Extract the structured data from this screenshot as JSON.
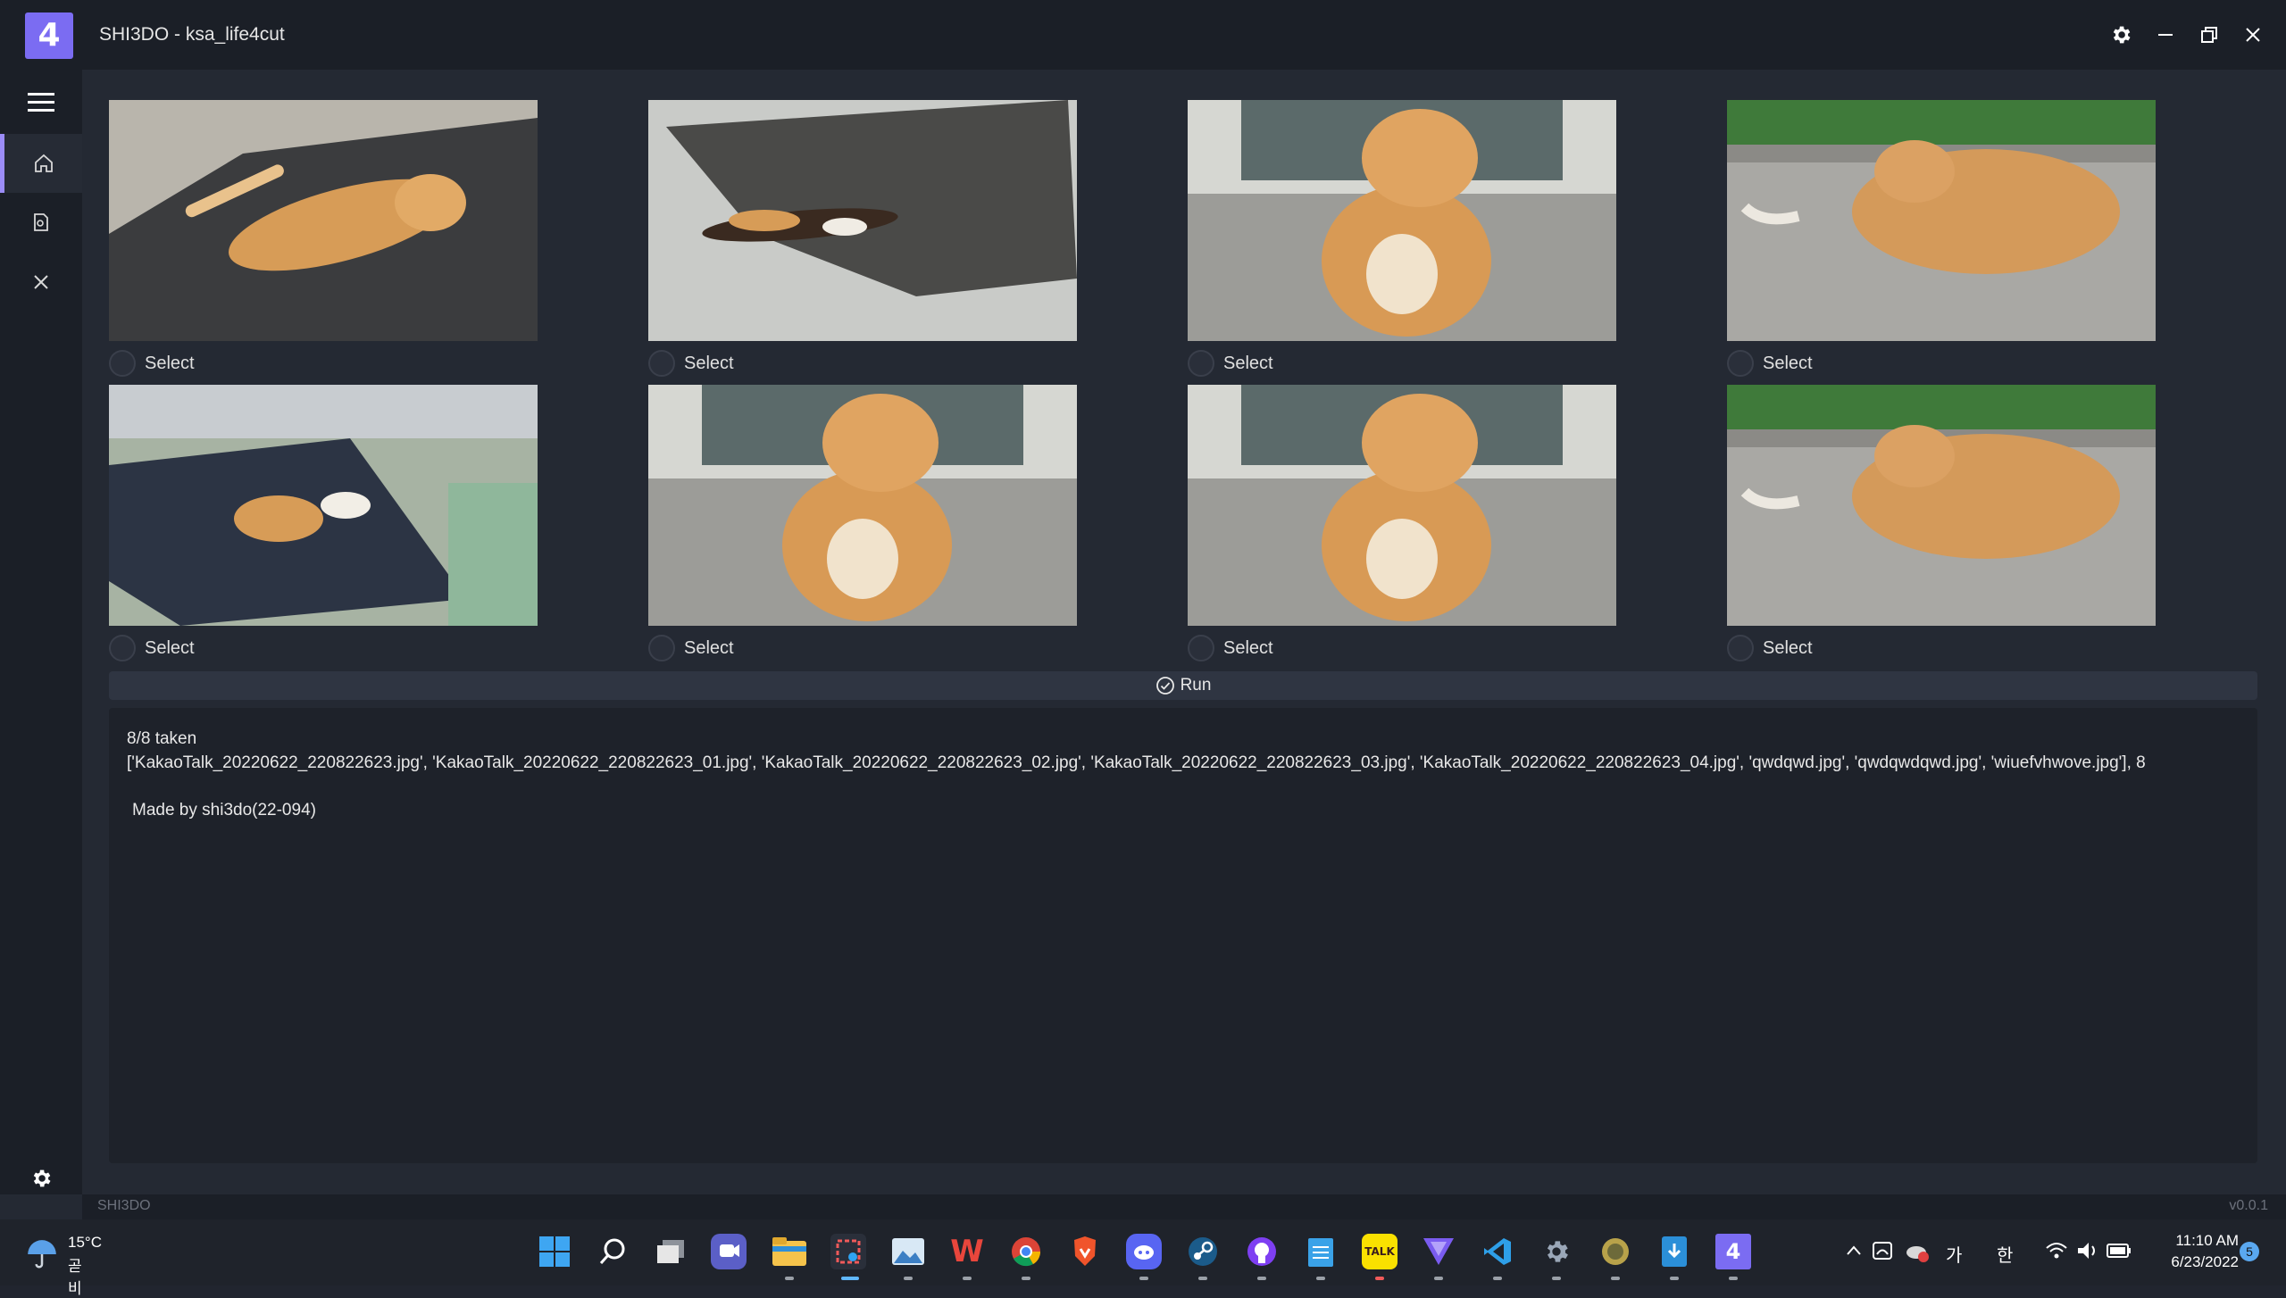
{
  "window": {
    "logo_glyph": "4",
    "title": "SHI3DO - ksa_life4cut",
    "controls": [
      "gear-icon",
      "minimize-icon",
      "restore-icon",
      "close-icon"
    ]
  },
  "sidebar": {
    "items": [
      {
        "icon": "hamburger-menu-icon"
      },
      {
        "icon": "home-icon",
        "active": true
      },
      {
        "icon": "document-icon"
      },
      {
        "icon": "close-icon"
      }
    ],
    "bottom_icon": "gear-icon"
  },
  "gallery": {
    "cards": [
      {
        "select_label": "Select",
        "photo": "orange cat lying on its back on a dark mat"
      },
      {
        "select_label": "Select",
        "photo": "calico cat lying on a dark mat on tiles"
      },
      {
        "select_label": "Select",
        "photo": "chubby orange cat sitting in front of a door"
      },
      {
        "select_label": "Select",
        "photo": "orange cat lying on gravel near bushes"
      },
      {
        "select_label": "Select",
        "photo": "two cats lying on a dark mat"
      },
      {
        "select_label": "Select",
        "photo": "chubby orange cat sitting in front of a door"
      },
      {
        "select_label": "Select",
        "photo": "chubby orange cat sitting in front of a door"
      },
      {
        "select_label": "Select",
        "photo": "orange cat lying on gravel near bushes"
      }
    ]
  },
  "run_button": {
    "label": "Run",
    "icon": "check-circle-icon"
  },
  "log": {
    "line1": "8/8 taken",
    "line2": "['KakaoTalk_20220622_220822623.jpg', 'KakaoTalk_20220622_220822623_01.jpg', 'KakaoTalk_20220622_220822623_02.jpg', 'KakaoTalk_20220622_220822623_03.jpg', 'KakaoTalk_20220622_220822623_04.jpg', 'qwdqwd.jpg', 'qwdqwdqwd.jpg', 'wiuefvhwove.jpg'], 8",
    "line3": "Made by shi3do(22-094)"
  },
  "status_bar": {
    "left": "SHI3DO",
    "right": "v0.0.1"
  },
  "taskbar": {
    "weather_temp": "15°C",
    "weather_desc": "곧 비",
    "apps": [
      "windows-start-icon",
      "search-icon",
      "task-view-icon",
      "teams-chat-icon",
      "file-explorer-icon",
      "snipping-tool-icon",
      "photos-icon",
      "wps-office-icon",
      "chrome-icon",
      "brave-icon",
      "discord-icon",
      "steam-icon",
      "github-icon",
      "notepad-icon",
      "kakaotalk-icon",
      "vivaldi-icon",
      "vscode-icon",
      "settings-icon",
      "app-icon",
      "python-installer-icon",
      "shi3do-app-icon"
    ],
    "tray": {
      "ime_1": "가",
      "ime_2": "한",
      "time": "11:10 AM",
      "date": "6/23/2022",
      "notification_count": "5"
    }
  },
  "colors": {
    "accent": "#7b6cf2",
    "background": "#242933",
    "titlebar": "#1b1f27",
    "panel": "#1e222a"
  }
}
